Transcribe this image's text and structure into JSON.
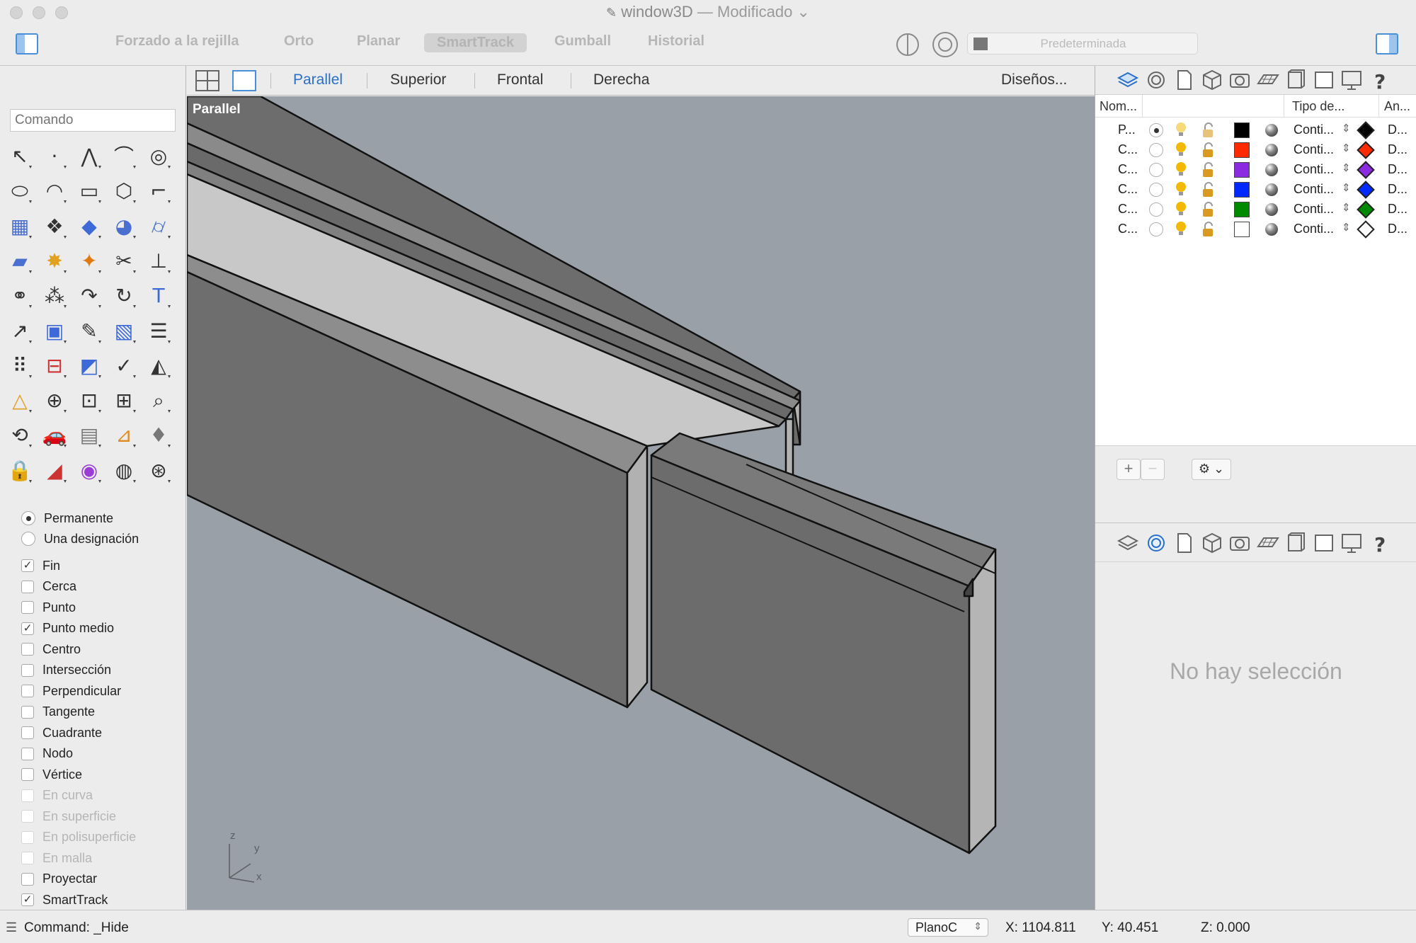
{
  "window": {
    "title": "window3D",
    "status": "— Modificado",
    "title_chevron": "⌄"
  },
  "toolbar": {
    "items": [
      "Forzado a la rejilla",
      "Orto",
      "Planar",
      "SmartTrack",
      "Gumball",
      "Historial"
    ],
    "layer_dropdown": "Predeterminada"
  },
  "command": {
    "placeholder": "Comando",
    "last_command": "Command: _Hide"
  },
  "osnap": {
    "mode_permanent": "Permanente",
    "mode_once": "Una designación",
    "items": [
      {
        "label": "Fin",
        "checked": true,
        "enabled": true
      },
      {
        "label": "Cerca",
        "checked": false,
        "enabled": true
      },
      {
        "label": "Punto",
        "checked": false,
        "enabled": true
      },
      {
        "label": "Punto medio",
        "checked": true,
        "enabled": true
      },
      {
        "label": "Centro",
        "checked": false,
        "enabled": true
      },
      {
        "label": "Intersección",
        "checked": false,
        "enabled": true
      },
      {
        "label": "Perpendicular",
        "checked": false,
        "enabled": true
      },
      {
        "label": "Tangente",
        "checked": false,
        "enabled": true
      },
      {
        "label": "Cuadrante",
        "checked": false,
        "enabled": true
      },
      {
        "label": "Nodo",
        "checked": false,
        "enabled": true
      },
      {
        "label": "Vértice",
        "checked": false,
        "enabled": true
      },
      {
        "label": "En curva",
        "checked": false,
        "enabled": false
      },
      {
        "label": "En superficie",
        "checked": false,
        "enabled": false
      },
      {
        "label": "En polisuperficie",
        "checked": false,
        "enabled": false
      },
      {
        "label": "En malla",
        "checked": false,
        "enabled": false
      },
      {
        "label": "Proyectar",
        "checked": false,
        "enabled": true
      },
      {
        "label": "SmartTrack",
        "checked": true,
        "enabled": true
      }
    ]
  },
  "viewport": {
    "tabs": [
      "Parallel",
      "Superior",
      "Frontal",
      "Derecha"
    ],
    "active_tab": "Parallel",
    "layouts_button": "Diseños...",
    "label": "Parallel",
    "axis_labels": {
      "z": "z",
      "y": "y",
      "x": "x"
    }
  },
  "layers": {
    "headers": {
      "name": "Nom...",
      "linetype": "Tipo de...",
      "width": "An..."
    },
    "rows": [
      {
        "name": "P...",
        "current": true,
        "color": "#000000",
        "linetype": "Conti...",
        "print_color": "#000000",
        "print_width": "D..."
      },
      {
        "name": "C...",
        "current": false,
        "color": "#ff2a00",
        "linetype": "Conti...",
        "print_color": "#ff2a00",
        "print_width": "D..."
      },
      {
        "name": "C...",
        "current": false,
        "color": "#8a2be2",
        "linetype": "Conti...",
        "print_color": "#8a2be2",
        "print_width": "D..."
      },
      {
        "name": "C...",
        "current": false,
        "color": "#0028ff",
        "linetype": "Conti...",
        "print_color": "#0028ff",
        "print_width": "D..."
      },
      {
        "name": "C...",
        "current": false,
        "color": "#008a00",
        "linetype": "Conti...",
        "print_color": "#008a00",
        "print_width": "D..."
      },
      {
        "name": "C...",
        "current": false,
        "color": "#ffffff",
        "linetype": "Conti...",
        "print_color": "#ffffff",
        "print_width": "D..."
      }
    ],
    "add_label": "+",
    "remove_label": "−",
    "gear_label": "⚙ ⌄"
  },
  "properties": {
    "empty_message": "No hay selección"
  },
  "status": {
    "cplane": "PlanoC",
    "x": "X: 1104.811",
    "y": "Y: 40.451",
    "z": "Z: 0.000"
  },
  "colors": {
    "accent": "#2a6fc9",
    "viewport_bg": "#99a0a8"
  }
}
